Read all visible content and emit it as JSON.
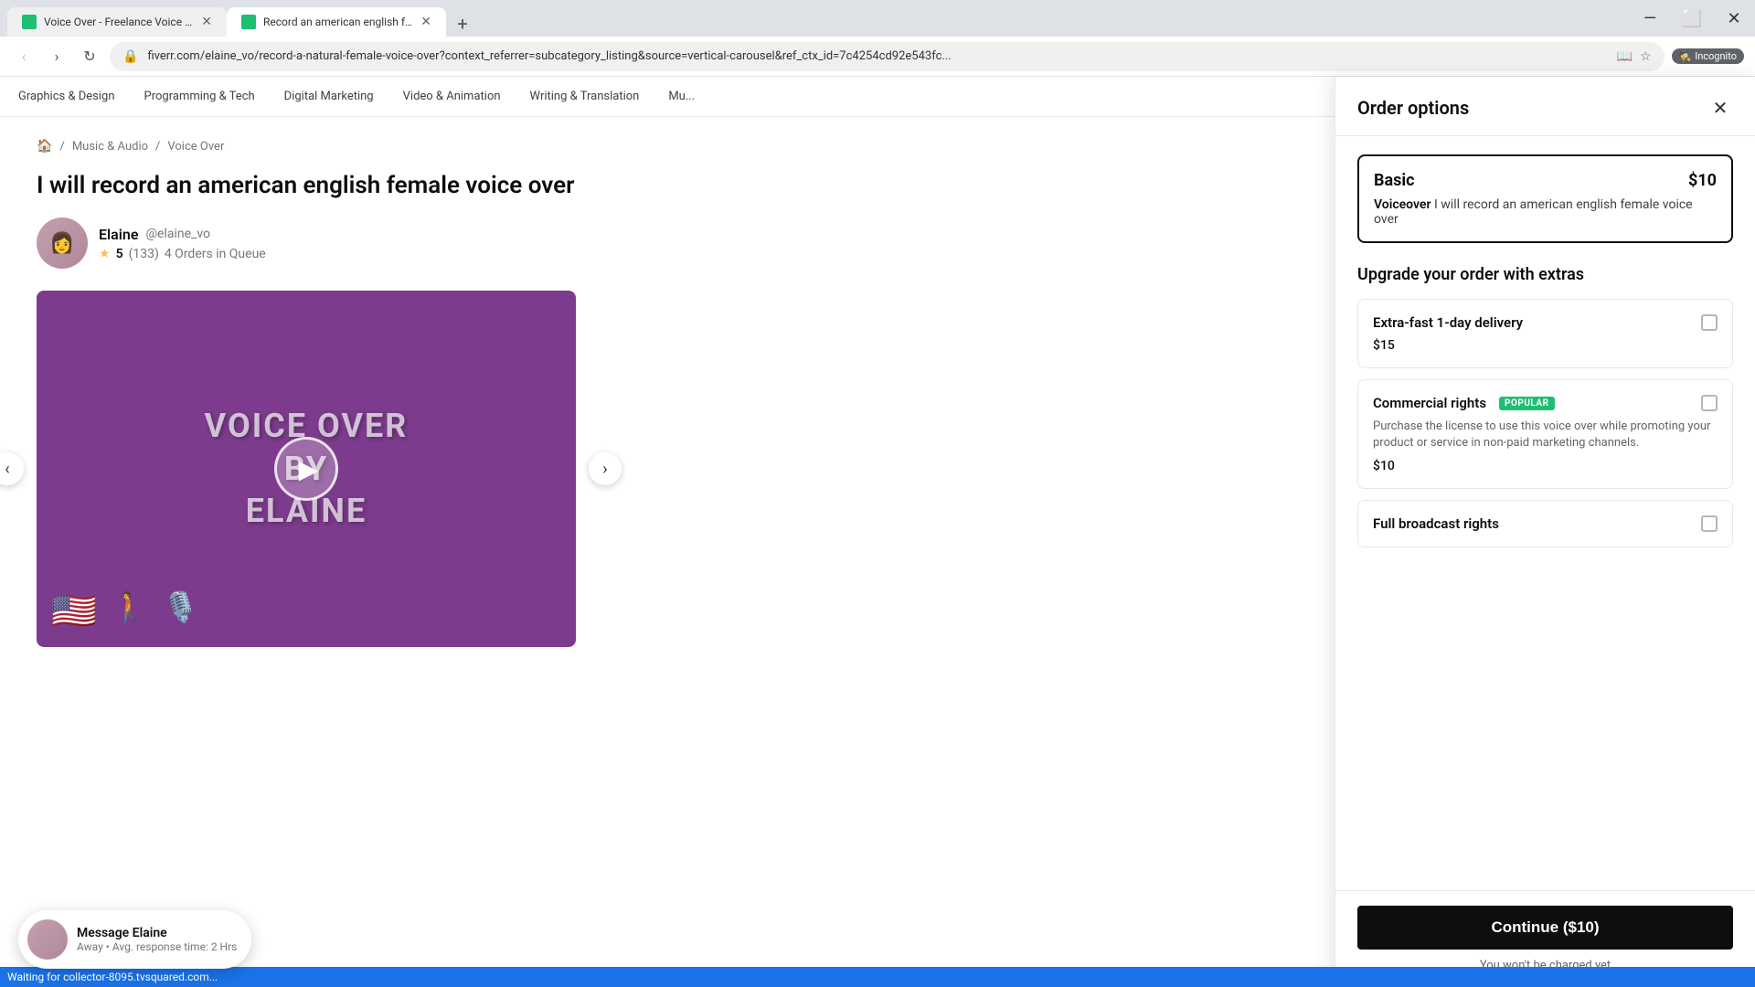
{
  "browser": {
    "tabs": [
      {
        "id": "tab1",
        "title": "Voice Over - Freelance Voice A...",
        "active": false,
        "favicon": "fiverr"
      },
      {
        "id": "tab2",
        "title": "Record an american english fe...",
        "active": true,
        "favicon": "fiverr"
      }
    ],
    "address": "fiverr.com/elaine_vo/record-a-natural-female-voice-over?context_referrer=subcategory_listing&source=vertical-carousel&ref_ctx_id=7c4254cd92e543fc...",
    "incognito_label": "Incognito"
  },
  "nav": {
    "categories": [
      "Graphics & Design",
      "Programming & Tech",
      "Digital Marketing",
      "Video & Animation",
      "Writing & Translation",
      "Mu..."
    ]
  },
  "breadcrumb": {
    "home": "🏠",
    "category": "Music & Audio",
    "subcategory": "Voice Over"
  },
  "gig": {
    "title": "I will record an american english female voice over",
    "seller": {
      "name": "Elaine",
      "handle": "@elaine_vo",
      "rating": "5",
      "review_count": "(133)",
      "queue": "4 Orders in Queue"
    },
    "gallery": {
      "line1": "VOICE OVER",
      "line2": "BY",
      "line3": "ELAINE"
    }
  },
  "order_panel": {
    "title": "Order options",
    "package": {
      "name": "Basic",
      "price": "$10",
      "type": "Voiceover",
      "desc": "I will record an american english female voice over"
    },
    "extras_title": "Upgrade your order with extras",
    "extras": [
      {
        "id": "extra1",
        "name": "Extra-fast 1-day delivery",
        "price": "$15",
        "desc": "",
        "popular": false
      },
      {
        "id": "extra2",
        "name": "Commercial rights",
        "price": "$10",
        "desc": "Purchase the license to use this voice over while promoting your product or service in non-paid marketing channels.",
        "popular": true,
        "popular_label": "POPULAR"
      },
      {
        "id": "extra3",
        "name": "Full broadcast rights",
        "price": "",
        "desc": "",
        "popular": false
      }
    ],
    "continue_label": "Continue ($10)",
    "no_charge": "You won't be charged yet"
  },
  "message_widget": {
    "label": "Message Elaine",
    "status": "Away",
    "separator": "•",
    "response": "Avg. response time: 2 Hrs"
  },
  "status_bar": {
    "text": "Waiting for collector-8095.tvsquared.com..."
  }
}
